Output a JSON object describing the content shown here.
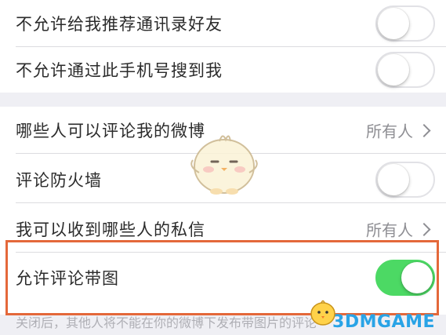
{
  "settings": {
    "rows": [
      {
        "label": "不允许给我推荐通讯录好友",
        "toggle": false
      },
      {
        "label": "不允许通过此手机号搜到我",
        "toggle": false
      },
      {
        "label": "哪些人可以评论我的微博",
        "value": "所有人"
      },
      {
        "label": "评论防火墙",
        "toggle": false
      },
      {
        "label": "我可以收到哪些人的私信",
        "value": "所有人"
      },
      {
        "label": "允许评论带图",
        "toggle": true
      }
    ],
    "footnote": "关闭后，其他人将不能在你的微博下发布带图片的评论"
  },
  "watermark": {
    "text": "3DMGAME",
    "color": "#29a3e6"
  },
  "colors": {
    "toggle_on": "#4cd964",
    "highlight_border": "#e4683a",
    "background": "#efeff4"
  },
  "icons": {
    "chevron": "chevron-right-icon",
    "mascot": "chick-mascot"
  }
}
